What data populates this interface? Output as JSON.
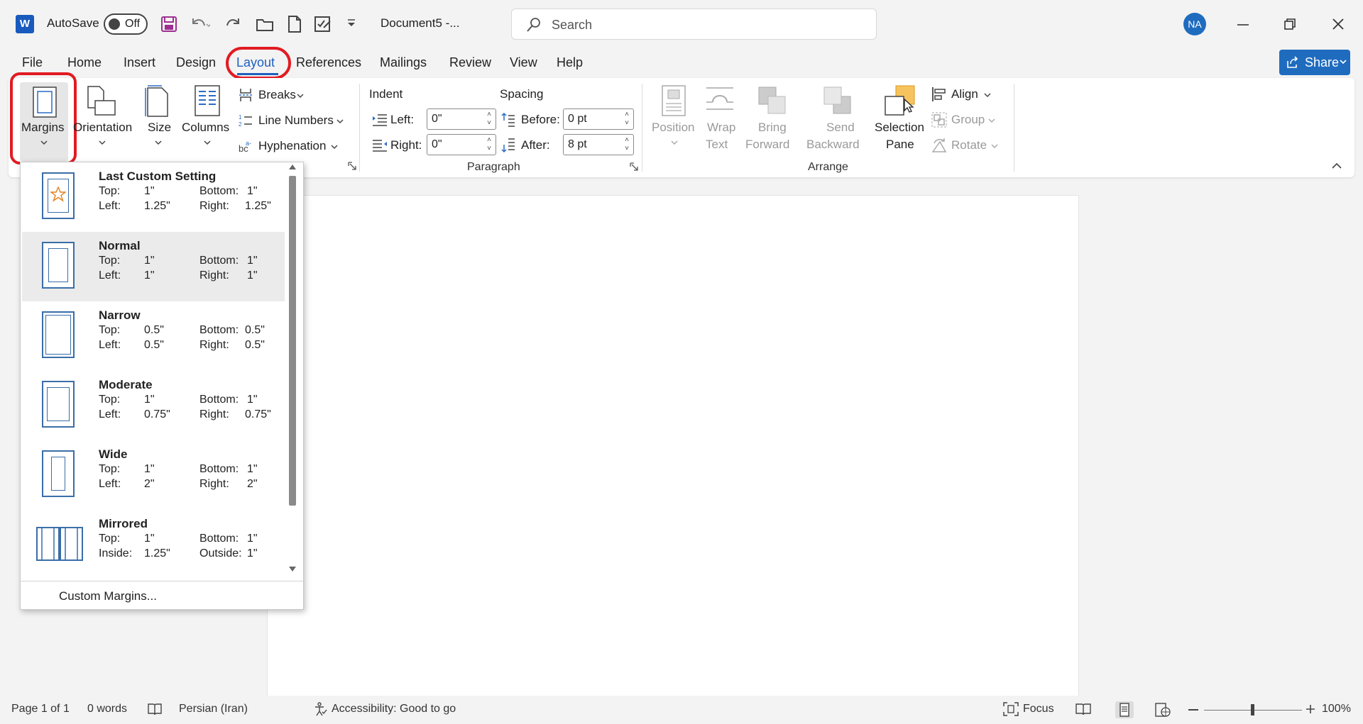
{
  "titlebar": {
    "app_logo": "W",
    "autosave_label": "AutoSave",
    "autosave_state": "Off",
    "doc_title": "Document5  -...",
    "search_placeholder": "Search",
    "user_initials": "NA"
  },
  "menu": {
    "items": [
      "File",
      "Home",
      "Insert",
      "Design",
      "Layout",
      "References",
      "Mailings",
      "Review",
      "View",
      "Help"
    ],
    "active": "Layout",
    "share_label": "Share"
  },
  "ribbon": {
    "page_setup": {
      "margins": "Margins",
      "orientation": "Orientation",
      "size": "Size",
      "columns": "Columns",
      "breaks": "Breaks",
      "line_numbers": "Line Numbers",
      "hyphenation": "Hyphenation"
    },
    "paragraph": {
      "indent_label": "Indent",
      "spacing_label": "Spacing",
      "left_label": "Left:",
      "left_value": "0\"",
      "right_label": "Right:",
      "right_value": "0\"",
      "before_label": "Before:",
      "before_value": "0 pt",
      "after_label": "After:",
      "after_value": "8 pt",
      "group_label": "Paragraph"
    },
    "arrange": {
      "position": "Position",
      "wrap_text_1": "Wrap",
      "wrap_text_2": "Text",
      "bring_forward_1": "Bring",
      "bring_forward_2": "Forward",
      "send_backward_1": "Send",
      "send_backward_2": "Backward",
      "selection_pane_1": "Selection",
      "selection_pane_2": "Pane",
      "align": "Align",
      "group": "Group",
      "rotate": "Rotate",
      "group_label": "Arrange"
    }
  },
  "margins_dropdown": {
    "options": [
      {
        "name": "Last Custom Setting",
        "top_label": "Top:",
        "top": "1\"",
        "bottom_label": "Bottom:",
        "bottom": "1\"",
        "left_label": "Left:",
        "left": "1.25\"",
        "right_label": "Right:",
        "right": "1.25\""
      },
      {
        "name": "Normal",
        "top_label": "Top:",
        "top": "1\"",
        "bottom_label": "Bottom:",
        "bottom": "1\"",
        "left_label": "Left:",
        "left": "1\"",
        "right_label": "Right:",
        "right": "1\""
      },
      {
        "name": "Narrow",
        "top_label": "Top:",
        "top": "0.5\"",
        "bottom_label": "Bottom:",
        "bottom": "0.5\"",
        "left_label": "Left:",
        "left": "0.5\"",
        "right_label": "Right:",
        "right": "0.5\""
      },
      {
        "name": "Moderate",
        "top_label": "Top:",
        "top": "1\"",
        "bottom_label": "Bottom:",
        "bottom": "1\"",
        "left_label": "Left:",
        "left": "0.75\"",
        "right_label": "Right:",
        "right": "0.75\""
      },
      {
        "name": "Wide",
        "top_label": "Top:",
        "top": "1\"",
        "bottom_label": "Bottom:",
        "bottom": "1\"",
        "left_label": "Left:",
        "left": "2\"",
        "right_label": "Right:",
        "right": "2\""
      },
      {
        "name": "Mirrored",
        "top_label": "Top:",
        "top": "1\"",
        "bottom_label": "Bottom:",
        "bottom": "1\"",
        "left_label": "Inside:",
        "left": "1.25\"",
        "right_label": "Outside:",
        "right": "1\""
      }
    ],
    "selected": "Normal",
    "custom_margins": "Custom Margins..."
  },
  "statusbar": {
    "page": "Page 1 of 1",
    "words": "0 words",
    "language": "Persian (Iran)",
    "accessibility": "Accessibility: Good to go",
    "focus": "Focus",
    "zoom": "100%"
  },
  "colors": {
    "word_blue": "#185abd",
    "share_blue": "#1f6cbf",
    "highlight_red": "#e11b22"
  }
}
